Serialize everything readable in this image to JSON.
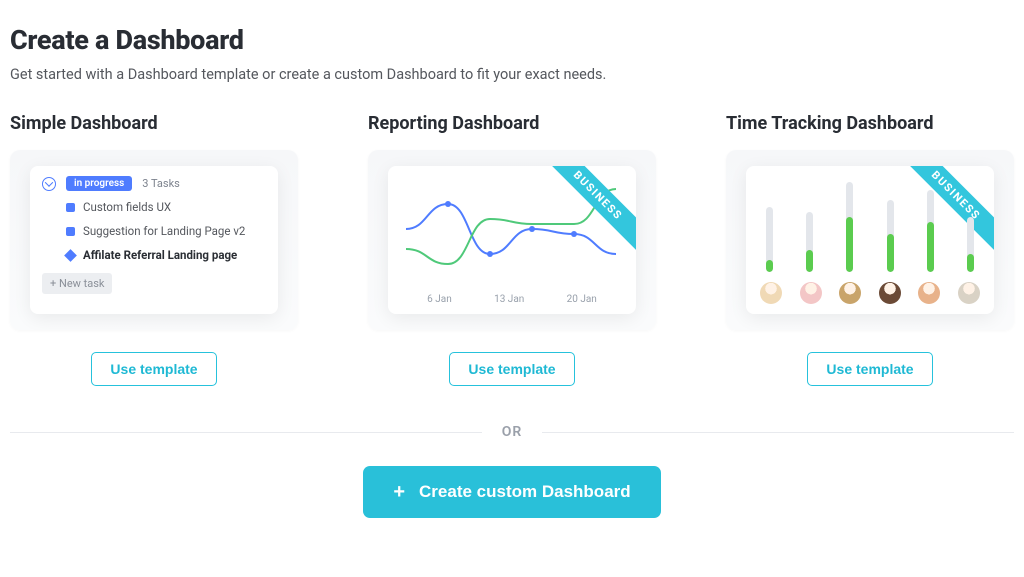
{
  "header": {
    "title": "Create a Dashboard",
    "subtitle": "Get started with a Dashboard template or create a custom Dashboard to fit your exact needs."
  },
  "cards": {
    "simple": {
      "title": "Simple Dashboard",
      "status_badge": "in progress",
      "task_count": "3 Tasks",
      "tasks": [
        "Custom fields UX",
        "Suggestion for Landing Page v2",
        "Affilate Referral Landing page"
      ],
      "new_task_label": "+ New task",
      "button": "Use template"
    },
    "reporting": {
      "title": "Reporting Dashboard",
      "ribbon": "BUSINESS",
      "x_ticks": [
        "6 Jan",
        "13 Jan",
        "20 Jan"
      ],
      "button": "Use template"
    },
    "time": {
      "title": "Time Tracking Dashboard",
      "ribbon": "BUSINESS",
      "bar_tracks": [
        65,
        60,
        90,
        72,
        82,
        55
      ],
      "bar_fills": [
        12,
        22,
        55,
        38,
        50,
        18
      ],
      "avatar_colors": [
        "#f0d9b5",
        "#f3c6c6",
        "#c9a46a",
        "#6b4a36",
        "#e8b28a",
        "#d9d2c5"
      ],
      "button": "Use template"
    }
  },
  "divider": {
    "or": "OR"
  },
  "create": {
    "label": "Create custom Dashboard"
  },
  "colors": {
    "accent": "#29c0d9",
    "blue": "#4f7cff",
    "green": "#5bcc4f"
  },
  "chart_data": {
    "type": "line",
    "title": "",
    "xlabel": "",
    "ylabel": "",
    "x": [
      "6 Jan",
      "13 Jan",
      "20 Jan"
    ],
    "series": [
      {
        "name": "series-blue",
        "color": "#4f7cff",
        "values_rel": [
          0.55,
          0.8,
          0.3,
          0.55,
          0.5,
          0.3
        ]
      },
      {
        "name": "series-green",
        "color": "#4fc97a",
        "values_rel": [
          0.35,
          0.2,
          0.65,
          0.6,
          0.6,
          0.95
        ]
      }
    ]
  }
}
